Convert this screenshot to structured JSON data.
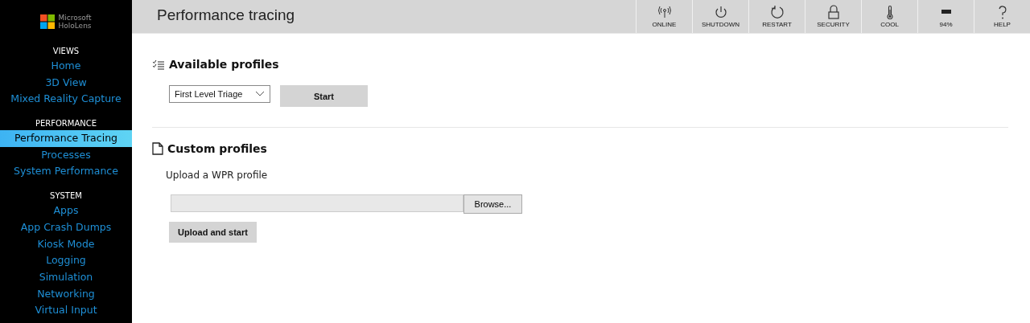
{
  "logo": {
    "line1": "Microsoft",
    "line2": "HoloLens"
  },
  "sidebar": {
    "sections": [
      {
        "heading": "VIEWS",
        "items": [
          {
            "label": "Home",
            "selected": false
          },
          {
            "label": "3D View",
            "selected": false
          },
          {
            "label": "Mixed Reality Capture",
            "selected": false
          }
        ]
      },
      {
        "heading": "PERFORMANCE",
        "items": [
          {
            "label": "Performance Tracing",
            "selected": true
          },
          {
            "label": "Processes",
            "selected": false
          },
          {
            "label": "System Performance",
            "selected": false
          }
        ]
      },
      {
        "heading": "SYSTEM",
        "items": [
          {
            "label": "Apps",
            "selected": false
          },
          {
            "label": "App Crash Dumps",
            "selected": false
          },
          {
            "label": "Kiosk Mode",
            "selected": false
          },
          {
            "label": "Logging",
            "selected": false
          },
          {
            "label": "Simulation",
            "selected": false
          },
          {
            "label": "Networking",
            "selected": false
          },
          {
            "label": "Virtual Input",
            "selected": false
          }
        ]
      }
    ]
  },
  "header": {
    "title": "Performance tracing",
    "status": [
      {
        "kind": "wifi",
        "label": "ONLINE"
      },
      {
        "kind": "power",
        "label": "SHUTDOWN"
      },
      {
        "kind": "restart",
        "label": "RESTART"
      },
      {
        "kind": "lock",
        "label": "SECURITY"
      },
      {
        "kind": "thermometer",
        "label": "COOL"
      },
      {
        "kind": "battery",
        "label": "94%"
      },
      {
        "kind": "help",
        "label": "HELP"
      }
    ]
  },
  "available": {
    "heading": "Available profiles",
    "dropdown": "First Level Triage",
    "button": "Start"
  },
  "custom": {
    "heading": "Custom profiles",
    "label": "Upload a WPR profile",
    "browse": "Browse...",
    "button": "Upload and start"
  }
}
